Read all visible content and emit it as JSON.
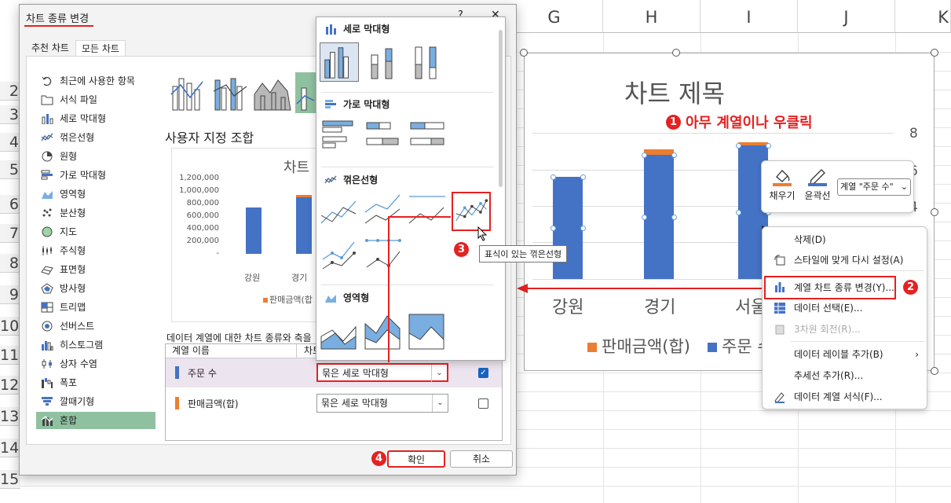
{
  "sheet": {
    "columns": [
      "G",
      "H",
      "I",
      "J",
      "K"
    ],
    "rows": [
      "2",
      "3",
      "4",
      "5",
      "6",
      "7",
      "8",
      "9",
      "10",
      "11",
      "12",
      "13",
      "14",
      "15"
    ]
  },
  "chart": {
    "title": "차트 제목",
    "categories": [
      "강원",
      "경기",
      "서울"
    ],
    "axis_right_1": "8",
    "axis_right_2": "6",
    "axis_right_3": "4",
    "legend": [
      "판매금액(합)",
      "주문 수"
    ],
    "colors": {
      "orders": "#4472c4",
      "sales": "#ed7d31"
    }
  },
  "chart_data": {
    "type": "bar",
    "title": "차트 제목",
    "categories": [
      "강원",
      "경기",
      "서울"
    ],
    "series": [
      {
        "name": "주문 수",
        "values": [
          740000,
          900000,
          970000
        ]
      },
      {
        "name": "판매금액(합)",
        "values": [
          0,
          40000,
          20000
        ]
      }
    ],
    "ylim": [
      0,
      1200000
    ],
    "yticks": [
      "1,200,000",
      "1,000,000",
      "800,000",
      "600,000",
      "400,000",
      "200,000",
      "-"
    ]
  },
  "annotations": {
    "step1": "1",
    "step1_text": "아무 계열이나 우클릭",
    "step2": "2",
    "step3": "3",
    "step4": "4"
  },
  "mini_toolbar": {
    "fill_label": "채우기",
    "outline_label": "윤곽선",
    "series_select": "계열 \"주문 수\""
  },
  "context_menu": {
    "items": [
      "삭제(D)",
      "스타일에 맞게 다시 설정(A)",
      "계열 차트 종류 변경(Y)...",
      "데이터 선택(E)...",
      "3차원 회전(R)...",
      "데이터 레이블 추가(B)",
      "추세선 추가(R)...",
      "데이터 계열 서식(F)..."
    ]
  },
  "dialog": {
    "title": "차트 종류 변경",
    "close": "✕",
    "help": "?",
    "tabs": [
      "추천 차트",
      "모든 차트"
    ],
    "categories": [
      "최근에 사용한 항목",
      "서식 파일",
      "세로 막대형",
      "꺾은선형",
      "원형",
      "가로 막대형",
      "영역형",
      "분산형",
      "지도",
      "주식형",
      "표면형",
      "방사형",
      "트리맵",
      "선버스트",
      "히스토그램",
      "상자 수염",
      "폭포",
      "깔때기형",
      "혼합"
    ],
    "custom_heading": "사용자 지정 조합",
    "preview_title": "차트",
    "preview_categories": [
      "강원",
      "경기"
    ],
    "preview_legend": "판매금액(합",
    "series_caption": "데이터 계열에 대한 차트 종류와 축을",
    "table_hdr_name": "계열 이름",
    "table_hdr_type": "차트",
    "rows": [
      {
        "name": "주문 수",
        "type": "묶은 세로 막대형",
        "secondary": true
      },
      {
        "name": "판매금액(합)",
        "type": "묶은 세로 막대형",
        "secondary": false
      }
    ],
    "ok": "확인",
    "cancel": "취소"
  },
  "gallery": {
    "sections": [
      "세로 막대형",
      "가로 막대형",
      "꺾은선형",
      "영역형"
    ],
    "tooltip": "표식이 있는 꺾은선형"
  }
}
